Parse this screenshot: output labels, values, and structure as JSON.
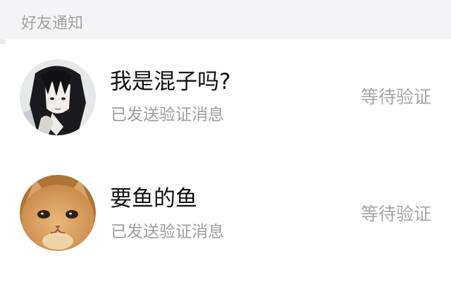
{
  "section": {
    "title": "好友通知"
  },
  "requests": [
    {
      "name": "我是混子吗?",
      "message": "已发送验证消息",
      "status": "等待验证",
      "avatar": "anime-boy-avatar"
    },
    {
      "name": "要鱼的鱼",
      "message": "已发送验证消息",
      "status": "等待验证",
      "avatar": "orange-cat-avatar"
    }
  ],
  "colors": {
    "header_bg": "#f5f5f7",
    "header_text": "#a3a3a8",
    "name_text": "#111111",
    "sub_text": "#9e9ea3",
    "status_text": "#a6a6aa"
  }
}
